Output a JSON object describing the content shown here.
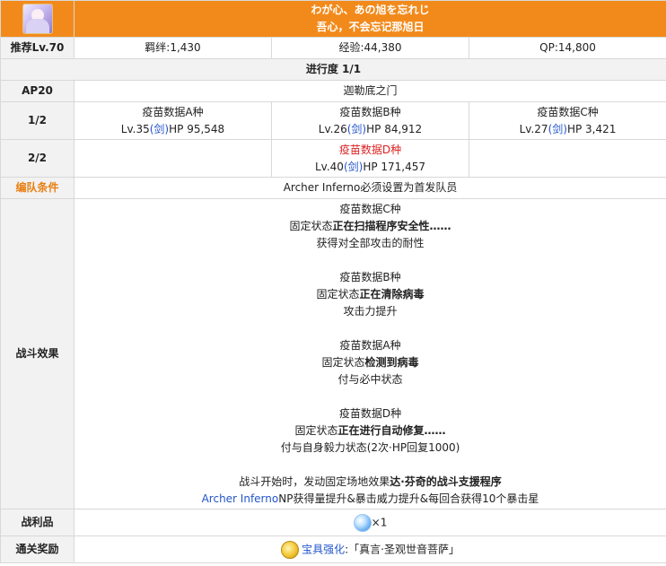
{
  "header": {
    "title_jp": "わが心、あの旭を忘れじ",
    "title_cn": "吾心，不会忘记那旭日"
  },
  "stats": {
    "level_label": "推荐Lv.70",
    "bond": "羁绊:1,430",
    "exp": "经验:44,380",
    "qp": "QP:14,800"
  },
  "progress": "进行度 1/1",
  "ap_row": {
    "label": "AP20",
    "location": "迦勒底之门"
  },
  "wave1": {
    "label": "1/2",
    "enemies": [
      {
        "name": "疫苗数据A种",
        "lv": "Lv.35",
        "cls": "(剑)",
        "hp": "HP 95,548"
      },
      {
        "name": "疫苗数据B种",
        "lv": "Lv.26",
        "cls": "(剑)",
        "hp": "HP 84,912"
      },
      {
        "name": "疫苗数据C种",
        "lv": "Lv.27",
        "cls": "(剑)",
        "hp": "HP 3,421"
      }
    ]
  },
  "wave2": {
    "label": "2/2",
    "enemy": {
      "name": "疫苗数据D种",
      "lv": "Lv.40",
      "cls": "(剑)",
      "hp": "HP 171,457"
    }
  },
  "formation": {
    "label": "编队条件",
    "text": "Archer Inferno必须设置为首发队员"
  },
  "effects": {
    "label": "战斗效果",
    "c": {
      "name": "疫苗数据C种",
      "state_prefix": "固定状态",
      "state": "正在扫描程序安全性……",
      "desc": "获得对全部攻击的耐性"
    },
    "b": {
      "name": "疫苗数据B种",
      "state_prefix": "固定状态",
      "state": "正在清除病毒",
      "desc": "攻击力提升"
    },
    "a": {
      "name": "疫苗数据A种",
      "state_prefix": "固定状态",
      "state": "检测到病毒",
      "desc": "付与必中状态"
    },
    "d": {
      "name": "疫苗数据D种",
      "state_prefix": "固定状态",
      "state": "正在进行自动修复……",
      "desc": "付与自身毅力状态(2次·HP回复1000)"
    },
    "field_prefix": "战斗开始时，发动固定场地效果",
    "field_name": "达·芬奇的战斗支援程序",
    "servant_link": "Archer Inferno",
    "servant_effect": "NP获得量提升&暴击威力提升&每回合获得10个暴击星"
  },
  "drops": {
    "label": "战利品",
    "count": "×1",
    "icon": "crystal-gem-icon"
  },
  "reward": {
    "label": "通关奖励",
    "icon": "gold-medal-icon",
    "link": "宝具强化",
    "colon": ":",
    "text": "「真言·圣观世音菩萨」"
  },
  "colors": {
    "header_bg": "#f28a1b",
    "label_bg": "#f2f2f2",
    "link": "#2255cc",
    "enemy_red": "#dd2222",
    "label_orange": "#e87f12"
  }
}
